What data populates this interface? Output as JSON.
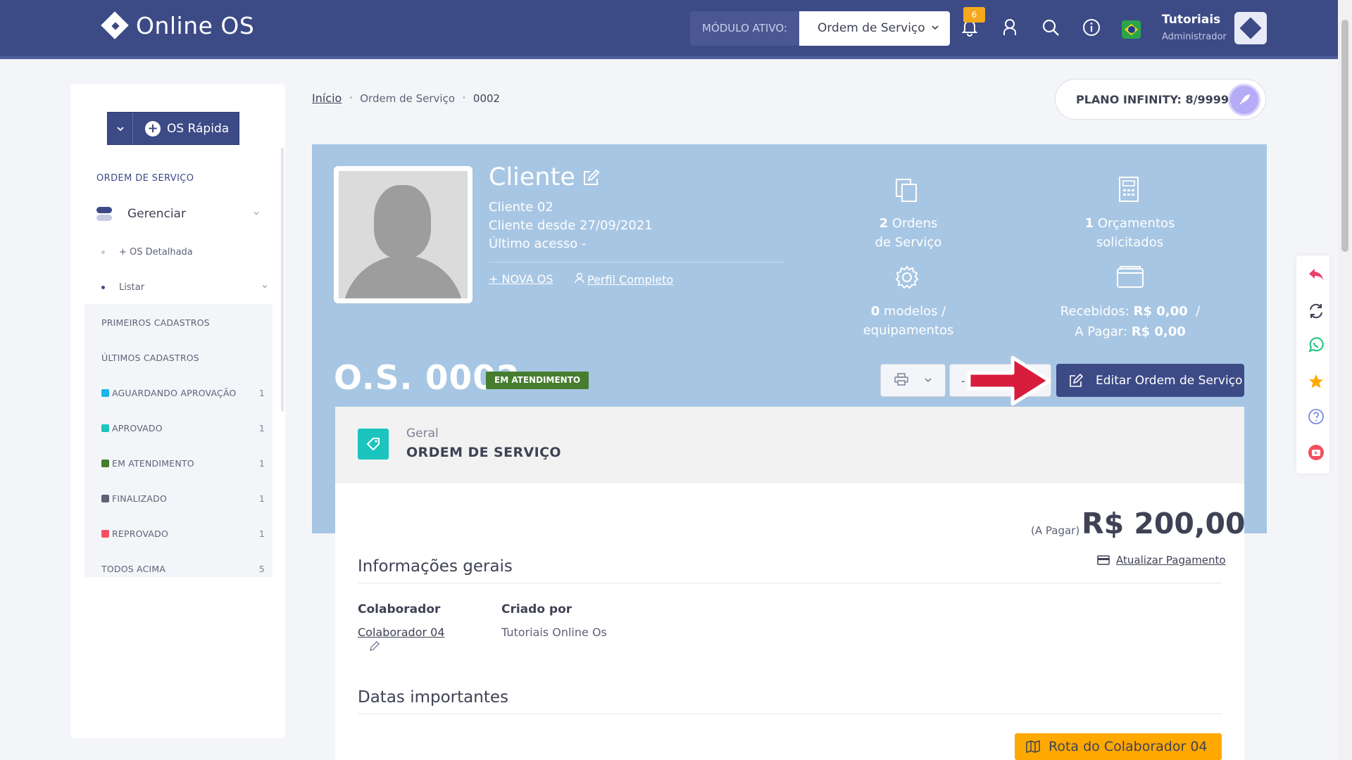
{
  "header": {
    "logo_text": "Online OS",
    "module_label": "MÓDULO ATIVO:",
    "module_value": "Ordem de Serviço",
    "notifications_count": "6",
    "user_name": "Tutoriais",
    "user_role": "Administrador"
  },
  "sidebar": {
    "quick_button": "OS Rápida",
    "section_title": "ORDEM DE SERVIÇO",
    "manage_label": "Gerenciar",
    "sub_detailed": "+ OS Detalhada",
    "sub_list": "Listar",
    "list_items": [
      {
        "label": "PRIMEIROS CADASTROS",
        "count": "",
        "color": ""
      },
      {
        "label": "ÚLTIMOS CADASTROS",
        "count": "",
        "color": ""
      },
      {
        "label": "AGUARDANDO APROVAÇÃO",
        "count": "1",
        "color": "#1ab7ea"
      },
      {
        "label": "APROVADO",
        "count": "1",
        "color": "#1bc5bd"
      },
      {
        "label": "EM ATENDIMENTO",
        "count": "1",
        "color": "#467d2f"
      },
      {
        "label": "FINALIZADO",
        "count": "1",
        "color": "#5e6278"
      },
      {
        "label": "REPROVADO",
        "count": "1",
        "color": "#f64e60"
      },
      {
        "label": "TODOS ACIMA",
        "count": "5",
        "color": ""
      }
    ]
  },
  "breadcrumb": {
    "home": "Início",
    "section": "Ordem de Serviço",
    "current": "0002"
  },
  "plan": {
    "label": "PLANO INFINITY: 8/9999"
  },
  "client": {
    "title": "Cliente",
    "name": "Cliente 02",
    "since": "Cliente desde 27/09/2021",
    "last_access": "Último acesso -",
    "new_os_link": "NOVA OS",
    "profile_link": "Perfil Completo"
  },
  "stats": {
    "orders_count": "2",
    "orders_label_1": "Ordens",
    "orders_label_2": "de Serviço",
    "budgets_count": "1",
    "budgets_label_1": "Orçamentos",
    "budgets_label_2": "solicitados",
    "models_count": "0",
    "models_label_1": "modelos /",
    "models_label_2": "equipamentos",
    "received_label": "Recebidos:",
    "received_value": "R$ 0,00",
    "received_sep": "/",
    "to_pay_label": "A Pagar:",
    "to_pay_value": "R$ 0,00"
  },
  "order": {
    "title": "O.S. 0002",
    "status": "EM ATENDIMENTO",
    "mid_button": "-",
    "edit_button": "Editar Ordem de Serviço"
  },
  "card": {
    "subtitle": "Geral",
    "title": "ORDEM DE SERVIÇO",
    "pay_note": "(A Pagar)",
    "pay_amount": "R$ 200,00",
    "pay_update": "Atualizar Pagamento",
    "section_general": "Informações gerais",
    "collaborator_label": "Colaborador",
    "collaborator_value": "Colaborador 04",
    "created_by_label": "Criado por",
    "created_by_value": "Tutoriais Online Os",
    "section_dates": "Datas importantes",
    "route_button": "Rota do Colaborador 04"
  },
  "colors": {
    "header_bg": "#3c4a86",
    "hero_bg": "#a7c6e3",
    "status_badge": "#467d2f",
    "accent_yellow": "#ffa800",
    "accent_teal": "#1bc5bd"
  },
  "icons": [
    "bell-icon",
    "user-icon",
    "search-icon",
    "info-icon",
    "brazil-flag-icon",
    "reply-icon",
    "refresh-icon",
    "whatsapp-icon",
    "star-icon",
    "help-icon",
    "youtube-icon"
  ]
}
